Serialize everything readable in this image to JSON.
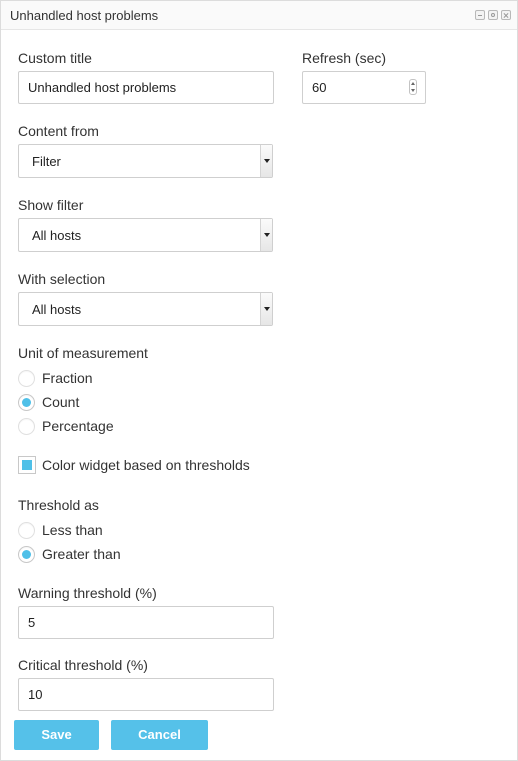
{
  "widget": {
    "title": "Unhandled host problems"
  },
  "fields": {
    "custom_title": {
      "label": "Custom title",
      "value": "Unhandled host problems"
    },
    "refresh": {
      "label": "Refresh (sec)",
      "value": "60"
    },
    "content_from": {
      "label": "Content from",
      "value": "Filter"
    },
    "show_filter": {
      "label": "Show filter",
      "value": "All hosts"
    },
    "with_selection": {
      "label": "With selection",
      "value": "All hosts"
    },
    "unit": {
      "label": "Unit of measurement",
      "options": [
        "Fraction",
        "Count",
        "Percentage"
      ],
      "selected": "Count"
    },
    "color_widget": {
      "label": "Color widget based on thresholds",
      "checked": true
    },
    "threshold_as": {
      "label": "Threshold as",
      "options": [
        "Less than",
        "Greater than"
      ],
      "selected": "Greater than"
    },
    "warning_threshold": {
      "label": "Warning threshold (%)",
      "value": "5"
    },
    "critical_threshold": {
      "label": "Critical threshold (%)",
      "value": "10"
    }
  },
  "buttons": {
    "save": "Save",
    "cancel": "Cancel"
  },
  "colors": {
    "accent": "#4fc0e8",
    "button": "#55c1e9"
  },
  "icons": {
    "header_controls": [
      "minimize-icon",
      "settings-icon",
      "close-icon"
    ],
    "select_arrow": "chevron-down-icon",
    "number_spinner": "spinner-icon"
  }
}
